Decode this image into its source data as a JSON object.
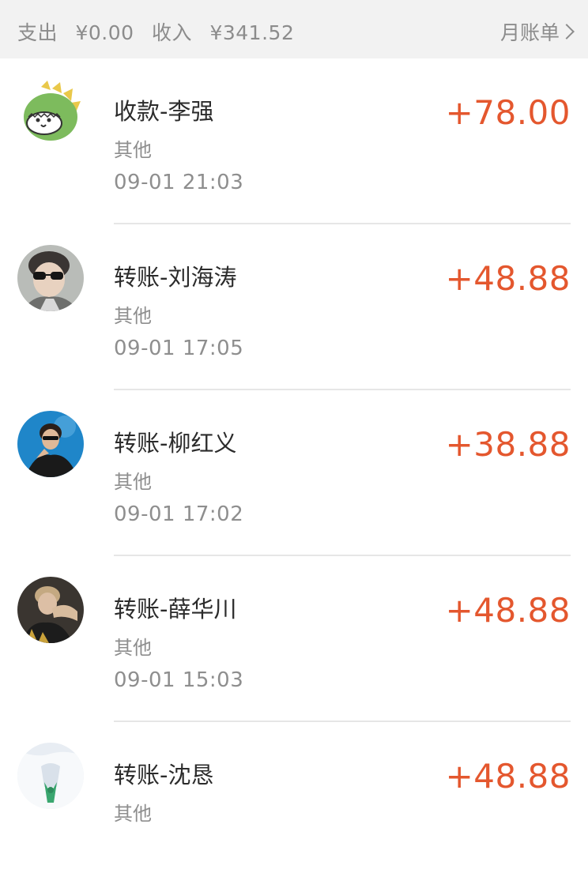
{
  "summary": {
    "expense_label": "支出",
    "expense_value": "¥0.00",
    "income_label": "收入",
    "income_value": "¥341.52",
    "month_bill_label": "月账单",
    "month_bill_icon": "chevron-right-icon"
  },
  "transactions": [
    {
      "title": "收款-李强",
      "category": "其他",
      "time": "09-01 21:03",
      "amount": "+78.00",
      "avatar": "cartoon-dinosaur-avatar"
    },
    {
      "title": "转账-刘海涛",
      "category": "其他",
      "time": "09-01 17:05",
      "amount": "+48.88",
      "avatar": "person-sunglasses-avatar"
    },
    {
      "title": "转账-柳红义",
      "category": "其他",
      "time": "09-01 17:02",
      "amount": "+38.88",
      "avatar": "person-blue-background-avatar"
    },
    {
      "title": "转账-薛华川",
      "category": "其他",
      "time": "09-01 15:03",
      "amount": "+48.88",
      "avatar": "person-dark-background-avatar"
    },
    {
      "title": "转账-沈恳",
      "category": "其他",
      "time": "",
      "amount": "+48.88",
      "avatar": "white-shirt-avatar"
    }
  ],
  "colors": {
    "amount": "#e4572e",
    "muted_text": "#8c8c8c",
    "summary_background": "#f2f2f2"
  }
}
